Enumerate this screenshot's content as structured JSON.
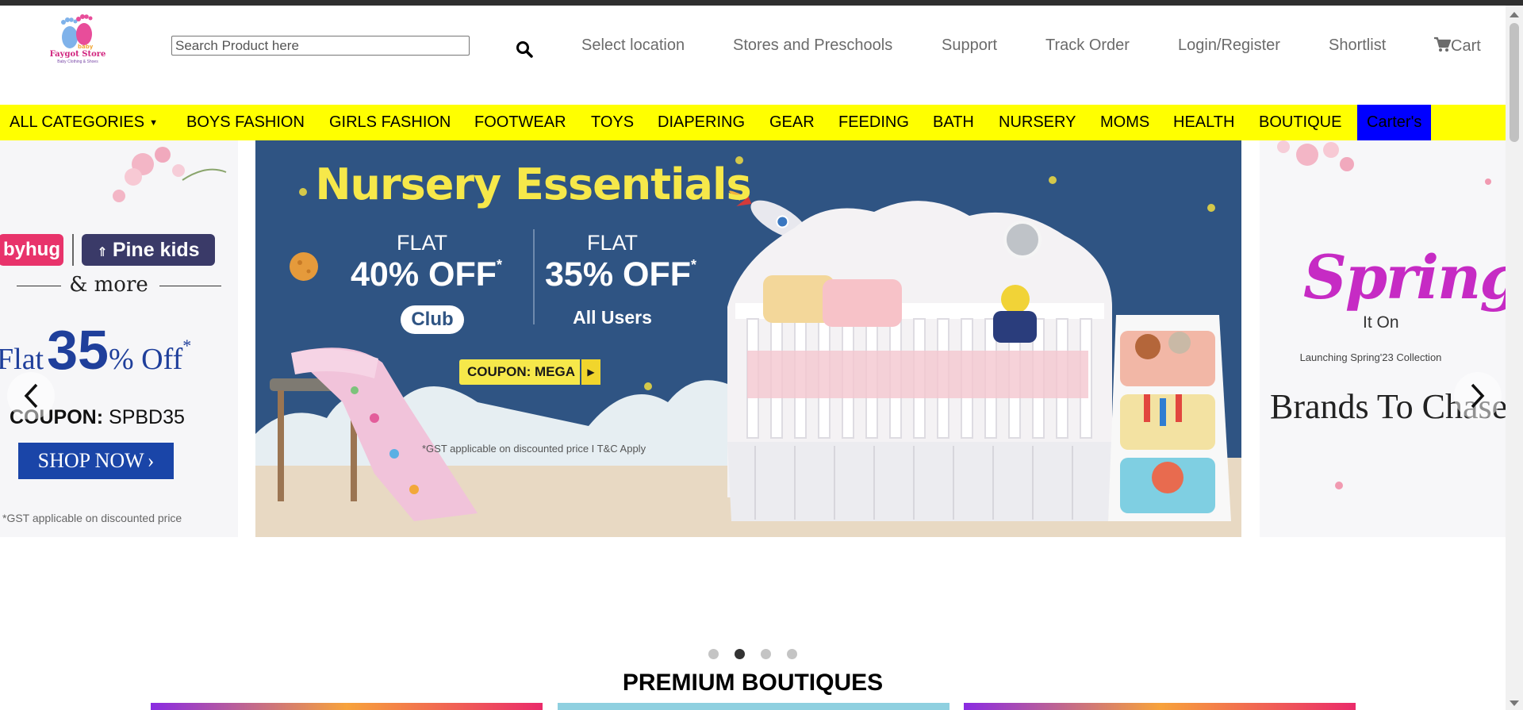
{
  "header": {
    "logo_text": "Faygot Store",
    "logo_tagline": "Baby Clothing & Shoes",
    "search_placeholder": "Search Product here",
    "nav": {
      "location": "Select location",
      "stores": "Stores and Preschools",
      "support": "Support",
      "track": "Track Order",
      "login": "Login/Register",
      "shortlist": "Shortlist",
      "cart": "Cart"
    }
  },
  "categories": {
    "all": "ALL CATEGORIES",
    "items": [
      "BOYS FASHION",
      "GIRLS FASHION",
      "FOOTWEAR",
      "TOYS",
      "DIAPERING",
      "GEAR",
      "FEEDING",
      "BATH",
      "NURSERY",
      "MOMS",
      "HEALTH",
      "BOUTIQUE",
      "Carter's"
    ]
  },
  "carousel": {
    "left": {
      "brand1": "byhug",
      "brand2": "Pine kids",
      "more": "& more",
      "flat_prefix": "Flat",
      "flat_value": "35",
      "flat_suffix": "% Off",
      "flat_star": "*",
      "coupon_label": "COUPON:",
      "coupon_code": "SPBD35",
      "shop_now": "SHOP NOW",
      "gst": "*GST applicable on discounted price"
    },
    "main": {
      "title": "Nursery Essentials",
      "flat1": "FLAT",
      "off1": "40% OFF",
      "club": "Club",
      "flat2": "FLAT",
      "off2": "35% OFF",
      "all_users": "All Users",
      "star": "*",
      "coupon": "COUPON: MEGA",
      "gst": "*GST applicable on discounted price I T&C Apply"
    },
    "right": {
      "spring": "Spring",
      "it_on": "It On",
      "launching": "Launching Spring'23 Collection",
      "brands": "Brands To Chase"
    },
    "active_slide": 2,
    "slide_count": 4
  },
  "sections": {
    "premium_boutiques": "PREMIUM BOUTIQUES"
  },
  "colors": {
    "category_bar": "#ffff00",
    "carters_bg": "#0000ff",
    "main_slide_bg": "#2f5483",
    "title_yellow": "#f6e84a"
  }
}
